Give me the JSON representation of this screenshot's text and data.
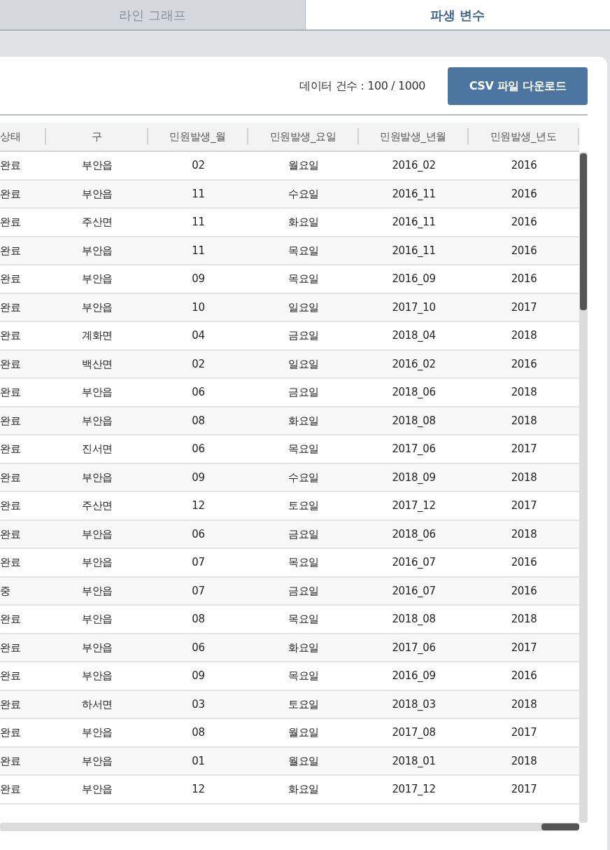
{
  "tabs": [
    {
      "label": "라인 그래프",
      "selected": false
    },
    {
      "label": "파생 변수",
      "selected": true
    }
  ],
  "data_count": "데이터 건수 : 100 / 1000",
  "download_button": "CSV 파일 다운로드",
  "table": {
    "columns": [
      "상태",
      "구",
      "민원발생_월",
      "민원발생_요일",
      "민원발생_년월",
      "민원발생_년도"
    ],
    "rows": [
      [
        "완료",
        "부안읍",
        "02",
        "월요일",
        "2016_02",
        "2016"
      ],
      [
        "완료",
        "부안읍",
        "11",
        "수요일",
        "2016_11",
        "2016"
      ],
      [
        "완료",
        "주산면",
        "11",
        "화요일",
        "2016_11",
        "2016"
      ],
      [
        "완료",
        "부안읍",
        "11",
        "목요일",
        "2016_11",
        "2016"
      ],
      [
        "완료",
        "부안읍",
        "09",
        "목요일",
        "2016_09",
        "2016"
      ],
      [
        "완료",
        "부안읍",
        "10",
        "일요일",
        "2017_10",
        "2017"
      ],
      [
        "완료",
        "계화면",
        "04",
        "금요일",
        "2018_04",
        "2018"
      ],
      [
        "완료",
        "백산면",
        "02",
        "일요일",
        "2016_02",
        "2016"
      ],
      [
        "완료",
        "부안읍",
        "06",
        "금요일",
        "2018_06",
        "2018"
      ],
      [
        "완료",
        "부안읍",
        "08",
        "화요일",
        "2018_08",
        "2018"
      ],
      [
        "완료",
        "진서면",
        "06",
        "목요일",
        "2017_06",
        "2017"
      ],
      [
        "완료",
        "부안읍",
        "09",
        "수요일",
        "2018_09",
        "2018"
      ],
      [
        "완료",
        "주산면",
        "12",
        "토요일",
        "2017_12",
        "2017"
      ],
      [
        "완료",
        "부안읍",
        "06",
        "금요일",
        "2018_06",
        "2018"
      ],
      [
        "완료",
        "부안읍",
        "07",
        "목요일",
        "2016_07",
        "2016"
      ],
      [
        "중",
        "부안읍",
        "07",
        "금요일",
        "2016_07",
        "2016"
      ],
      [
        "완료",
        "부안읍",
        "08",
        "목요일",
        "2018_08",
        "2018"
      ],
      [
        "완료",
        "부안읍",
        "06",
        "화요일",
        "2017_06",
        "2017"
      ],
      [
        "완료",
        "부안읍",
        "09",
        "목요일",
        "2016_09",
        "2016"
      ],
      [
        "완료",
        "하서면",
        "03",
        "토요일",
        "2018_03",
        "2018"
      ],
      [
        "완료",
        "부안읍",
        "08",
        "월요일",
        "2017_08",
        "2017"
      ],
      [
        "완료",
        "부안읍",
        "01",
        "월요일",
        "2018_01",
        "2018"
      ],
      [
        "완료",
        "부안읍",
        "12",
        "화요일",
        "2017_12",
        "2017"
      ]
    ]
  }
}
